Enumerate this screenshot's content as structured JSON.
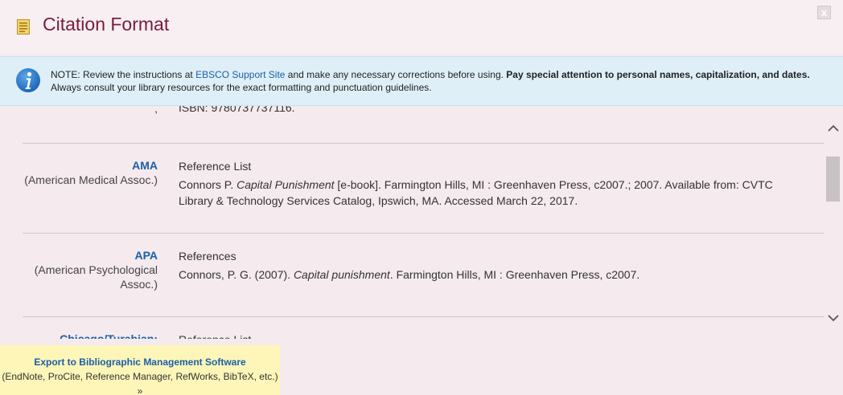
{
  "header": {
    "title": "Citation Format",
    "title_icon": "document-icon",
    "close_label": "x"
  },
  "note": {
    "prefix": "NOTE: Review the instructions at ",
    "link": "EBSCO Support Site",
    "middle": " and make any necessary corrections before using. ",
    "bold": "Pay special attention to personal names, capitalization, and dates.",
    "suffix": " Always consult your library resources for the exact formatting and punctuation guidelines."
  },
  "citations": [
    {
      "abbr": "",
      "style_name": ",",
      "heading": "",
      "text": "ISBN: 9780737737116."
    },
    {
      "abbr": "AMA",
      "style_name": "(American Medical Assoc.)",
      "heading": "Reference List",
      "text_before": "Connors P. ",
      "text_italic": "Capital Punishment",
      "text_after": " [e-book]. Farmington Hills, MI : Greenhaven Press, c2007.; 2007. Available from: CVTC Library & Technology Services Catalog, Ipswich, MA. Accessed March 22, 2017."
    },
    {
      "abbr": "APA",
      "style_name": "(American Psychological Assoc.)",
      "heading": "References",
      "text_before": "Connors, P. G. (2007). ",
      "text_italic": "Capital punishment",
      "text_after": ". Farmington Hills, MI : Greenhaven Press, c2007."
    },
    {
      "abbr": "Chicago/Turabian:",
      "style_name": "",
      "heading": "Reference List",
      "text_before": "",
      "text_italic": "",
      "text_after": ""
    }
  ],
  "export": {
    "title": "Export to Bibliographic Management Software",
    "subtitle": "(EndNote, ProCite, Reference Manager, RefWorks, BibTeX, etc.) »"
  },
  "colors": {
    "title": "#7a1c3a",
    "link": "#1a5fa8",
    "banner": "#dfeff8",
    "background": "#f5eaed",
    "export_bg": "#fdf6b8"
  }
}
